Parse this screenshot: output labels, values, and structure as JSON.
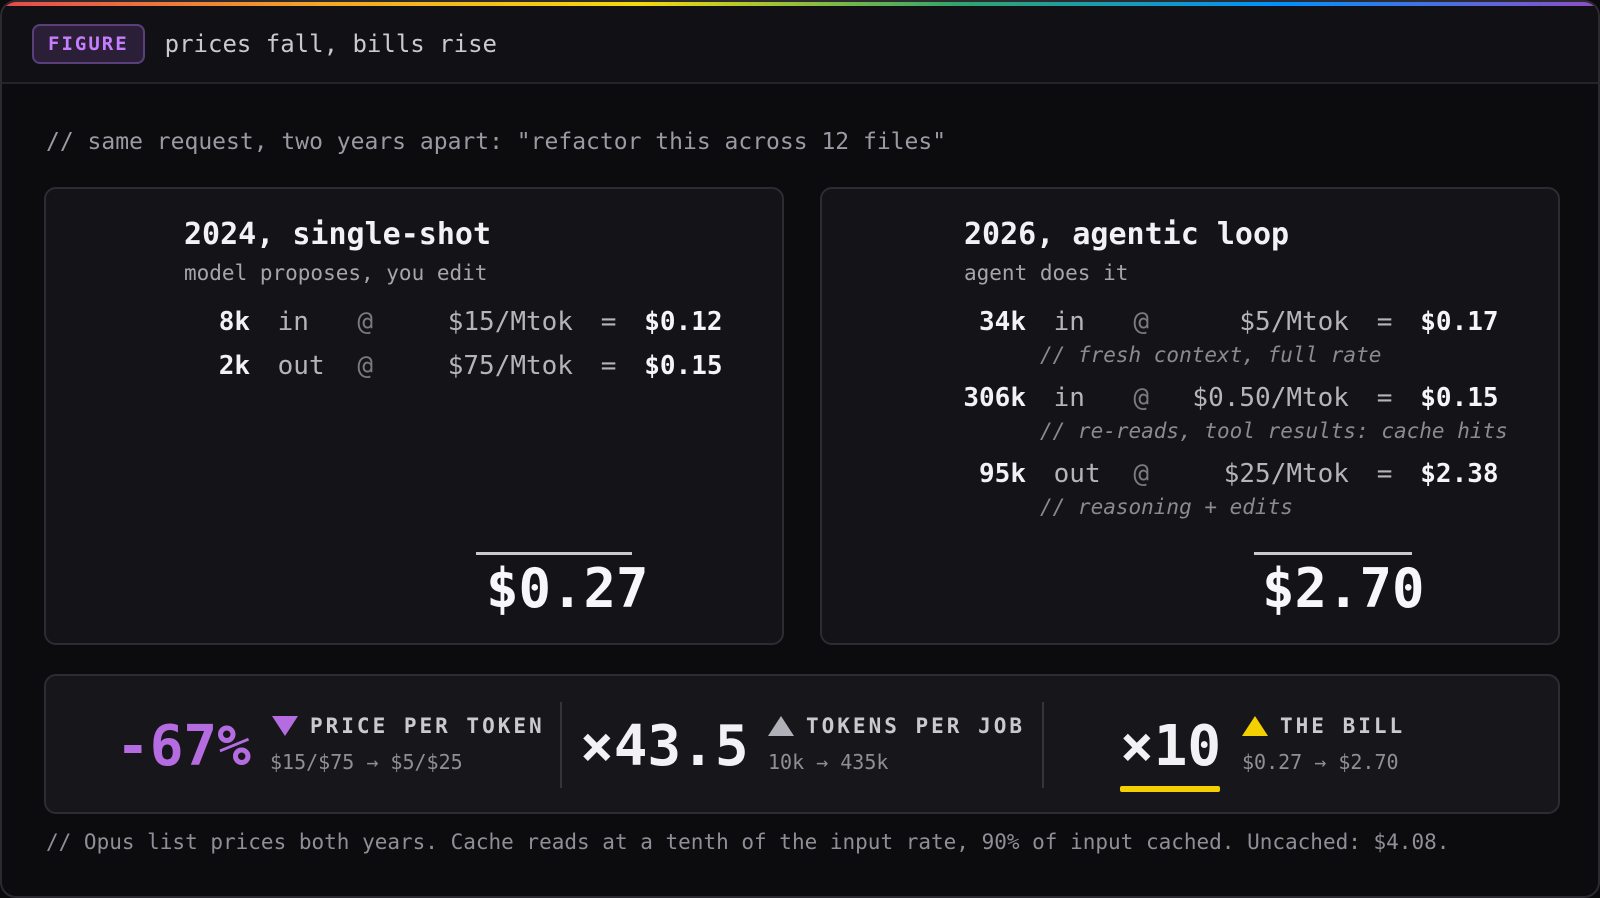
{
  "header": {
    "tag": "FIGURE",
    "title": "prices fall, bills rise"
  },
  "intro": "// same request, two years apart: \"refactor this across 12 files\"",
  "left_card": {
    "title": "2024, single-shot",
    "subtitle": "model proposes, you edit",
    "rows": [
      {
        "amount": "8k",
        "direction": "in",
        "at": "@",
        "rate": "$15/Mtok",
        "eq": "=",
        "cost": "$0.12"
      },
      {
        "amount": "2k",
        "direction": "out",
        "at": "@",
        "rate": "$75/Mtok",
        "eq": "=",
        "cost": "$0.15"
      }
    ],
    "total": "$0.27"
  },
  "right_card": {
    "title": "2026, agentic loop",
    "subtitle": "agent does it",
    "rows": [
      {
        "amount": "34k",
        "direction": "in",
        "at": "@",
        "rate": "$5/Mtok",
        "eq": "=",
        "cost": "$0.17",
        "note": "// fresh context, full rate"
      },
      {
        "amount": "306k",
        "direction": "in",
        "at": "@",
        "rate": "$0.50/Mtok",
        "eq": "=",
        "cost": "$0.15",
        "note": "// re-reads, tool results: cache hits"
      },
      {
        "amount": "95k",
        "direction": "out",
        "at": "@",
        "rate": "$25/Mtok",
        "eq": "=",
        "cost": "$2.38",
        "note": "// reasoning + edits"
      }
    ],
    "total": "$2.70"
  },
  "stats": [
    {
      "value": "-67%",
      "label": "PRICE PER TOKEN",
      "sub": "$15/$75 → $5/$25",
      "indicator": "down-triangle",
      "color": "#b56ce0"
    },
    {
      "value": "×43.5",
      "label": "TOKENS PER JOB",
      "sub": "10k → 435k",
      "indicator": "up-triangle",
      "color": "#b0b0b8"
    },
    {
      "value": "×10",
      "label": "THE BILL",
      "sub": "$0.27 → $2.70",
      "indicator": "up-triangle",
      "color": "#f5d000"
    }
  ],
  "footnote": "// Opus list prices both years. Cache reads at a tenth of the input rate, 90% of input cached. Uncached: $4.08."
}
